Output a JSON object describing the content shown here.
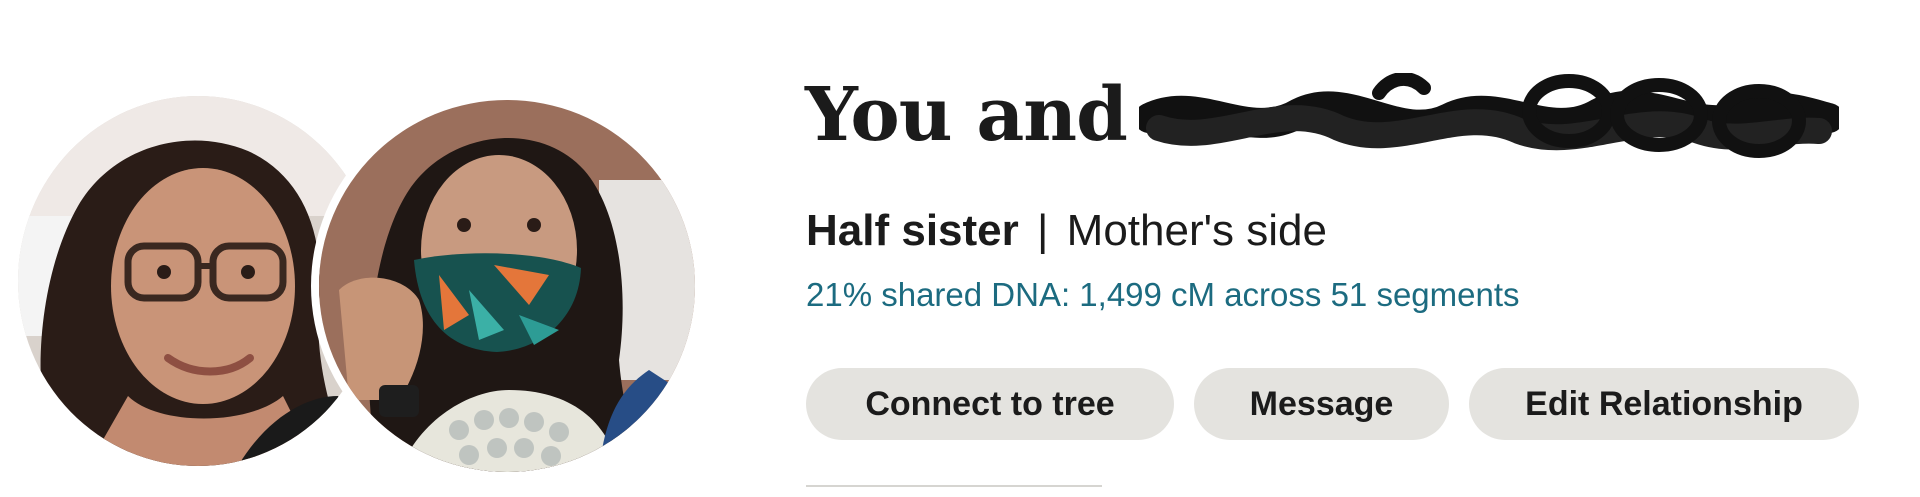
{
  "header": {
    "title_prefix": "You and"
  },
  "relationship": {
    "label": "Half sister",
    "separator": "|",
    "side": "Mother's side"
  },
  "dna": {
    "summary": "21% shared DNA: 1,499 cM across 51 segments"
  },
  "actions": {
    "connect_label": "Connect to tree",
    "message_label": "Message",
    "edit_label": "Edit Relationship"
  },
  "colors": {
    "dna_text": "#1c6b80",
    "button_bg": "#e4e3df",
    "text": "#1b1b1b"
  },
  "avatars": {
    "you": "user-photo",
    "match": "match-photo"
  }
}
